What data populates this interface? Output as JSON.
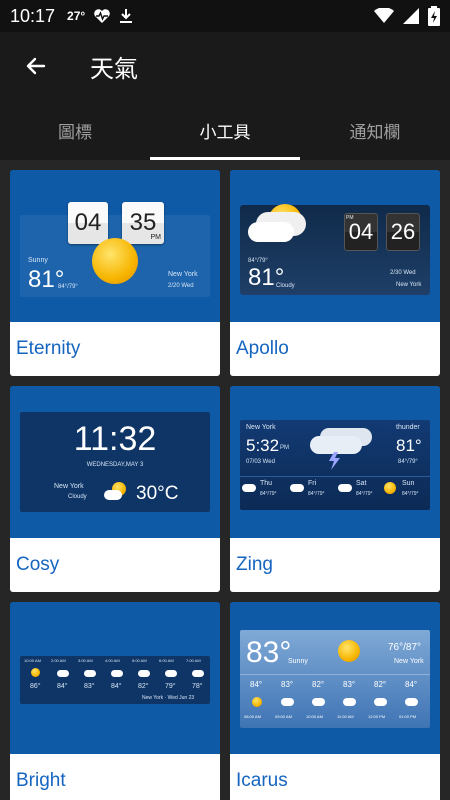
{
  "status": {
    "time": "10:17",
    "temp": "27°"
  },
  "appbar": {
    "title": "天氣"
  },
  "tabs": [
    {
      "label": "圖標",
      "active": false
    },
    {
      "label": "小工具",
      "active": true
    },
    {
      "label": "通知欄",
      "active": false
    }
  ],
  "widgets": [
    {
      "name": "Eternity",
      "hour": "04",
      "min": "35",
      "ampm": "PM",
      "cond": "Sunny",
      "temp": "81°",
      "range": "84°/79°",
      "city": "New York",
      "date": "2/20 Wed"
    },
    {
      "name": "Apollo",
      "hour": "04",
      "min": "26",
      "ampm": "PM",
      "cond": "Cloudy",
      "temp": "81°",
      "range": "84°/79°",
      "city": "New York",
      "date": "2/30 Wed"
    },
    {
      "name": "Cosy",
      "time": "11:32",
      "date": "WEDNESDAY,MAY 3",
      "city": "New York",
      "cond": "Cloudy",
      "temp": "30°C"
    },
    {
      "name": "Zing",
      "city": "New York",
      "time": "5:32",
      "ampm": "PM",
      "date": "07/03 Wed",
      "cond": "thunder",
      "temp": "81°",
      "range": "84°/79°",
      "days": [
        {
          "d": "Thu",
          "r": "84°/79°"
        },
        {
          "d": "Fri",
          "r": "84°/79°"
        },
        {
          "d": "Sat",
          "r": "84°/79°"
        },
        {
          "d": "Sun",
          "r": "84°/79°"
        }
      ]
    },
    {
      "name": "Bright",
      "hours": [
        "10:00 AM",
        "2:00 AM",
        "3:00 AM",
        "4:00 AM",
        "5:00 AM",
        "6:00 AM",
        "7:00 AM"
      ],
      "temps": [
        "86°",
        "84°",
        "83°",
        "84°",
        "82°",
        "79°",
        "78°"
      ],
      "footer": "New York · Wed Jun 23"
    },
    {
      "name": "Icarus",
      "temp": "83°",
      "cond": "Sunny",
      "hilo": "76°/87°",
      "city": "New York",
      "temps": [
        "84°",
        "83°",
        "82°",
        "83°",
        "82°",
        "84°"
      ],
      "hours": [
        "08:00 AM",
        "09:00 AM",
        "10:00 AM",
        "11:00 AM",
        "12:00 PM",
        "01:00 PM"
      ]
    }
  ]
}
